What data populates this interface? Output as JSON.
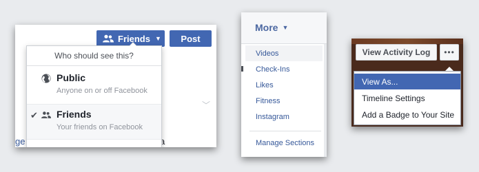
{
  "privacy_panel": {
    "friends_button_label": "Friends",
    "post_button_label": "Post",
    "menu_header": "Who should see this?",
    "options": [
      {
        "title": "Public",
        "subtitle": "Anyone on or off Facebook",
        "icon": "globe-icon",
        "selected": false
      },
      {
        "title": "Friends",
        "subtitle": "Your friends on Facebook",
        "icon": "friends-icon",
        "selected": true
      }
    ],
    "feed_left_fragment": "ge",
    "feed_right_fragment": "a"
  },
  "more_panel": {
    "tab_label": "More",
    "items": [
      "Videos",
      "Check-Ins",
      "Likes",
      "Fitness",
      "Instagram"
    ],
    "manage_label": "Manage Sections"
  },
  "profile_panel": {
    "activity_log_label": "View Activity Log",
    "more_dots_label": "•••",
    "menu_items": [
      "View As...",
      "Timeline Settings",
      "Add a Badge to Your Site"
    ]
  },
  "colors": {
    "page_background": "#e9ebee",
    "facebook_blue": "#4267b2",
    "link_blue": "#365899",
    "muted_text": "#90949c"
  }
}
